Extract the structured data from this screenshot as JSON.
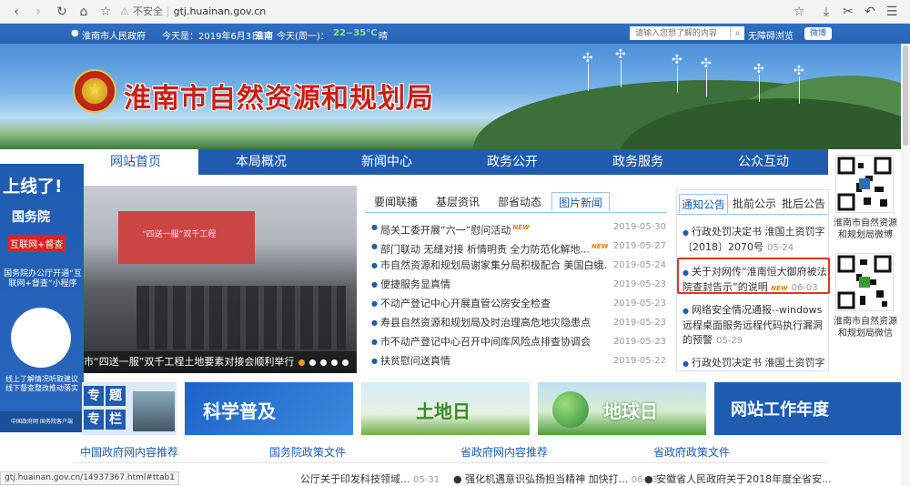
{
  "browser": {
    "nav_icons": [
      "back-icon",
      "forward-icon",
      "reload-icon",
      "home-icon",
      "star-icon"
    ],
    "insecure_label": "不安全",
    "url": "gtj.huainan.gov.cn",
    "right_icons": [
      "bookmark-star-icon",
      "download-icon",
      "scissors-icon",
      "undo-icon",
      "menu-icon"
    ]
  },
  "topbar": {
    "site_link": "淮南市人民政府",
    "date": "今天是：2019年6月3日",
    "city": "淮南",
    "weather": "今天(周一)：",
    "temp": "22~35°C",
    "weather_suffix": "晴",
    "search_placeholder": "请输入您想了解的内容",
    "accessibility": "无障碍浏览",
    "weibo": "微博"
  },
  "banner": {
    "title": "淮南市自然资源和规划局",
    "emblem_glyph": "★"
  },
  "nav": {
    "items": [
      "网站首页",
      "本局概况",
      "新闻中心",
      "政务公开",
      "政务服务",
      "公众互动"
    ]
  },
  "left_ad": {
    "headline": "上线了!",
    "gwy": "国务院",
    "tag": "互联网+督查",
    "text1": "国务院办公厅开通“互联网+督查”小程序",
    "text2": "线上了解情况听取建议 线下督查整改推动落实",
    "footer": "中国政府网   国务院客户端"
  },
  "photo": {
    "screen_text": "“四送一服”双千工程",
    "caption": "市“四送一服”双千工程土地要素对接会顺利举行"
  },
  "news": {
    "tabs": [
      "要闻联播",
      "基层资讯",
      "部省动态",
      "图片新闻"
    ],
    "new_badge": "NEW",
    "items": [
      {
        "title": "局关工委开展“六一”慰问活动",
        "date": "2019-05-30",
        "new": true
      },
      {
        "title": "部门联动 无缝对接 析情明责 全力防范化解地...",
        "date": "2019-05-27",
        "new": true
      },
      {
        "title": "市自然资源和规划局谢家集分局积极配合 美国白蛾...",
        "date": "2019-05-24",
        "new": false
      },
      {
        "title": "便捷服务显真情",
        "date": "2019-05-23",
        "new": false
      },
      {
        "title": "不动产登记中心开展直管公房安全检查",
        "date": "2019-05-23",
        "new": false
      },
      {
        "title": "寿县自然资源和规划局及时治理高危地灾隐患点",
        "date": "2019-05-23",
        "new": false
      },
      {
        "title": "市不动产登记中心召开中间库风险点排查协调会",
        "date": "2019-05-23",
        "new": false
      },
      {
        "title": "扶贫慰问送真情",
        "date": "2019-05-22",
        "new": false
      }
    ]
  },
  "notice": {
    "tabs": [
      "通知公告",
      "批前公示",
      "批后公告"
    ],
    "items": [
      {
        "text": "行政处罚决定书 淮国土资罚字〔2018〕2070号",
        "date": "05-24",
        "new": false
      },
      {
        "text": "关于对网传“淮南恒大御府被法院查封告示”的说明",
        "date": "06-03",
        "new": true
      },
      {
        "text": "网络安全情况通报--windows远程桌面服务远程代码执行漏洞的预警",
        "date": "05-29",
        "new": false
      },
      {
        "text": "行政处罚决定书 淮国土资罚字",
        "date": "",
        "new": false
      }
    ]
  },
  "qr": {
    "weibo_label": "淮南市自然资源和规划局微博",
    "wechat_label": "淮南市自然资源和规划局微信"
  },
  "features": {
    "special": [
      "专",
      "题",
      "专",
      "栏"
    ],
    "science": "科学普及",
    "land_day": "土地日",
    "earth_day": "地球日",
    "annual_report": "网站工作年度"
  },
  "bottom": {
    "headers": [
      "中国政府网内容推荐",
      "国务院政策文件",
      "省政府网内容推荐",
      "省政府政策文件"
    ],
    "rows": [
      {
        "text": "公厅关于印发科技领域...",
        "date": "05-31"
      },
      {
        "text": "强化机遇意识弘扬担当精神 加快打...",
        "date": "06-03"
      },
      {
        "text": "安徽省人民政府关于2018年度全省安..."
      }
    ]
  },
  "status_url": "gtj.huainan.gov.cn/14937367.html#ttab1"
}
